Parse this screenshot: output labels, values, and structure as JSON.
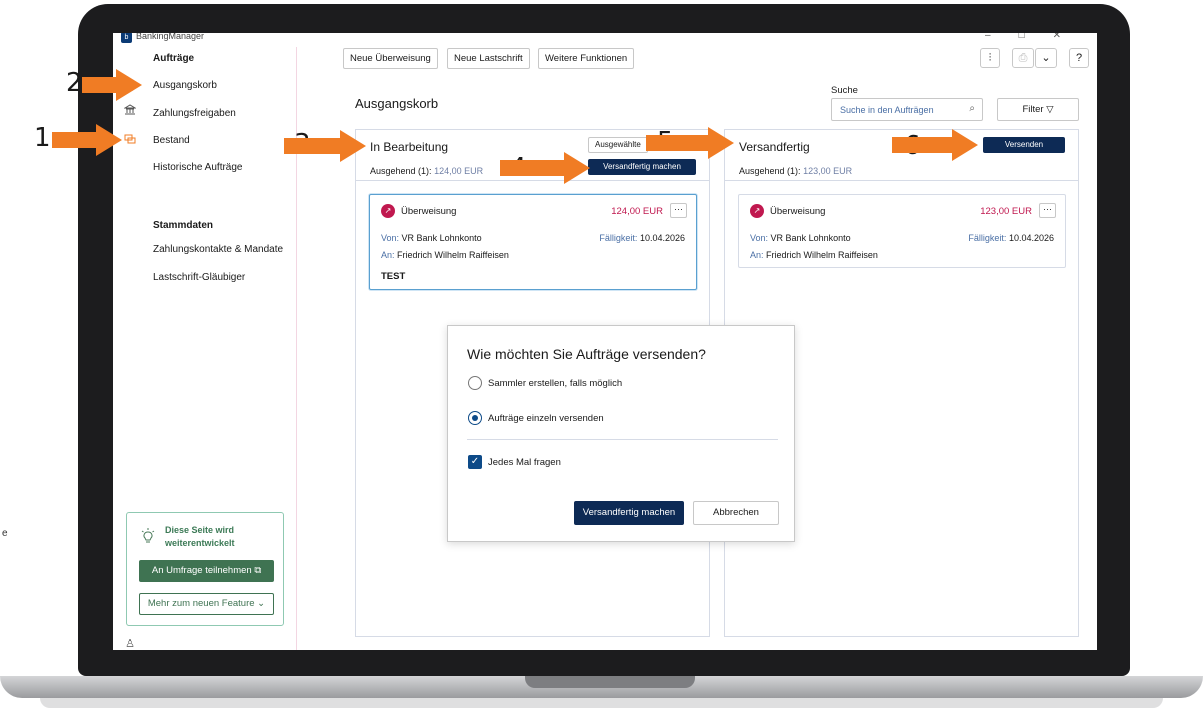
{
  "app": {
    "title": "BankingManager",
    "logo": "bm-logo-icon"
  },
  "sidebar": {
    "section1_title": "Aufträge",
    "items": [
      {
        "label": "Ausgangskorb"
      },
      {
        "label": "Zahlungsfreigaben"
      },
      {
        "label": "Bestand"
      },
      {
        "label": "Historische Aufträge"
      }
    ],
    "section2_title": "Stammdaten",
    "items2": [
      {
        "label": "Zahlungskontakte & Mandate"
      },
      {
        "label": "Lastschrift-Gläubiger"
      }
    ],
    "info": {
      "text": "Diese Seite wird weiterentwickelt",
      "survey_label": "An Umfrage teilnehmen",
      "more_label": "Mehr zum neuen Feature"
    }
  },
  "toolbar": {
    "new_transfer": "Neue Überweisung",
    "new_debit": "Neue Lastschrift",
    "more_functions": "Weitere Funktionen"
  },
  "page": {
    "title": "Ausgangskorb"
  },
  "search": {
    "label": "Suche",
    "placeholder": "Suche in den Aufträgen",
    "filter_label": "Filter"
  },
  "columns": {
    "in_progress": {
      "title": "In Bearbeitung",
      "outgoing_label": "Ausgehend (1):",
      "outgoing_amount": "124,00 EUR",
      "selected_button": "Ausgewählte",
      "ready_button": "Versandfertig machen",
      "card": {
        "type": "Überweisung",
        "amount": "124,00 EUR",
        "from_label": "Von:",
        "from_value": "VR Bank Lohnkonto",
        "due_label": "Fälligkeit:",
        "due_value": "10.04.2026",
        "to_label": "An:",
        "to_value": "Friedrich Wilhelm Raiffeisen",
        "note": "TEST"
      }
    },
    "ready": {
      "title": "Versandfertig",
      "outgoing_label": "Ausgehend (1):",
      "outgoing_amount": "123,00 EUR",
      "send_button": "Versenden",
      "card": {
        "type": "Überweisung",
        "amount": "123,00 EUR",
        "from_label": "Von:",
        "from_value": "VR Bank Lohnkonto",
        "due_label": "Fälligkeit:",
        "due_value": "10.04.2026",
        "to_label": "An:",
        "to_value": "Friedrich Wilhelm Raiffeisen"
      }
    }
  },
  "dialog": {
    "title": "Wie möchten Sie Aufträge versenden?",
    "option1": "Sammler erstellen, falls möglich",
    "option2": "Aufträge einzeln versenden",
    "selected_option": "Aufträge einzeln versenden",
    "checkbox_label": "Jedes Mal fragen",
    "checkbox_checked": true,
    "primary_button": "Versandfertig machen",
    "cancel_button": "Abbrechen"
  },
  "annotations": {
    "n1": "1",
    "n2": "2",
    "n3": "3",
    "n4": "4",
    "n5": "5",
    "n6": "6"
  },
  "stray_text": "e",
  "colors": {
    "accent_navy": "#0d2a55",
    "amount_red": "#c0184f",
    "arrow_orange": "#f07c24",
    "green": "#3f7352"
  }
}
